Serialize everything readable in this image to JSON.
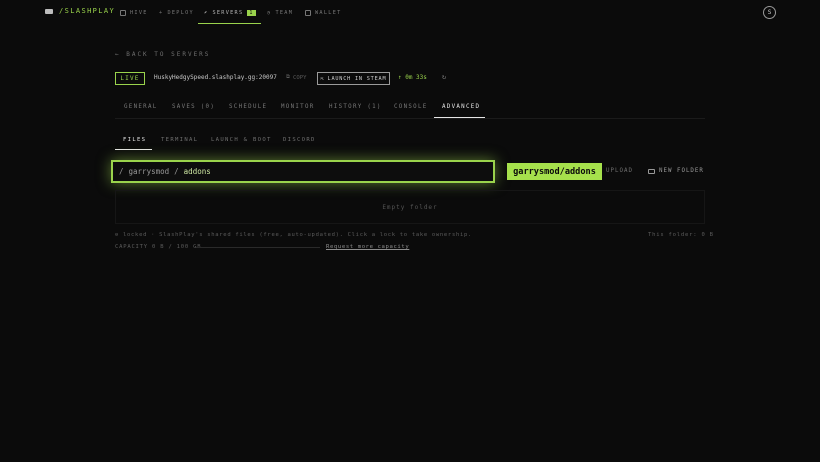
{
  "nav": {
    "logo": "/SLASHPLAY",
    "items": [
      {
        "label": "HIVE",
        "icon": "hive-icon"
      },
      {
        "label": "DEPLOY",
        "icon": "plus-icon"
      },
      {
        "label": "SERVERS",
        "icon": "rocket-icon",
        "count": "1"
      },
      {
        "label": "TEAM",
        "icon": "team-icon"
      },
      {
        "label": "WALLET",
        "icon": "wallet-icon"
      }
    ],
    "avatar": "S"
  },
  "back": "← BACK TO SERVERS",
  "server": {
    "status": "LIVE",
    "host": "HuskyHedgySpeed.slashplay.gg:20097",
    "copy": "COPY",
    "launch": "LAUNCH IN STEAM",
    "uptime": "↑ 0m 33s",
    "refresh": "↻"
  },
  "tabs": [
    "GENERAL",
    "SAVES (0)",
    "SCHEDULE",
    "MONITOR",
    "HISTORY (1)",
    "CONSOLE",
    "ADVANCED"
  ],
  "subtabs": [
    "FILES",
    "TERMINAL",
    "LAUNCH & BOOT",
    "DISCORD"
  ],
  "path": {
    "root": "/",
    "segment": "garrysmod",
    "sep": "/",
    "current": "addons",
    "badge": "garrysmod/addons"
  },
  "actions": {
    "upload": "UPLOAD",
    "new_folder": "NEW FOLDER"
  },
  "files": {
    "empty": "Empty folder"
  },
  "footer": {
    "locked": "⊖ locked · SlashPlay's shared files (free, auto-updated). Click a lock to take ownership.",
    "this_folder": "This folder: 0 B",
    "capacity": "CAPACITY 0 B / 100 GB",
    "request": "Request more capacity"
  },
  "colors": {
    "accent": "#9ad34c",
    "background": "#0b0b0b"
  }
}
